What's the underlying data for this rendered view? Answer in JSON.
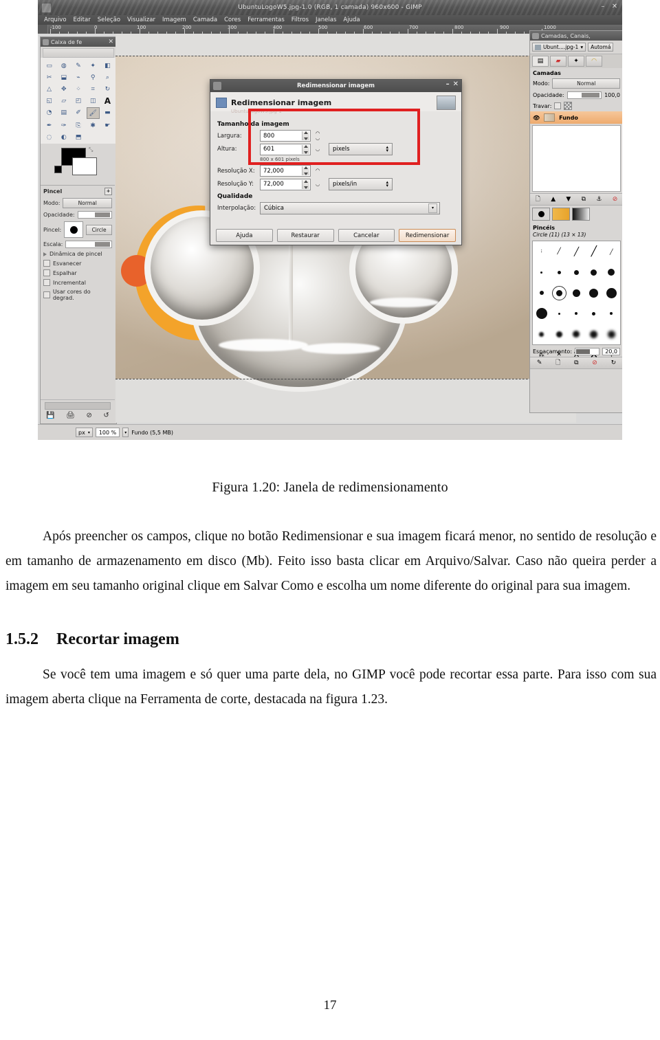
{
  "figure": {
    "window": {
      "title": "UbuntuLogoW5.jpg-1.0 (RGB, 1 camada) 960x600 - GIMP",
      "minimize": "–",
      "close": "✕"
    },
    "menubar": [
      "Arquivo",
      "Editar",
      "Seleção",
      "Visualizar",
      "Imagem",
      "Camada",
      "Cores",
      "Ferramentas",
      "Filtros",
      "Janelas",
      "Ajuda"
    ],
    "ruler": {
      "labels": [
        "-100",
        "0",
        "100",
        "200",
        "300",
        "400",
        "500",
        "600",
        "700",
        "800",
        "900",
        "1000"
      ]
    },
    "toolbox": {
      "title": "Caixa de fe",
      "close": "✕",
      "tools": [
        "rect-select-icon",
        "ellipse-select-icon",
        "free-select-icon",
        "fuzzy-select-icon",
        "select-by-color-icon",
        "scissors-select-icon",
        "foreground-select-icon",
        "paths-icon",
        "color-picker-icon",
        "zoom-icon",
        "measure-icon",
        "move-icon",
        "alignment-icon",
        "crop-icon",
        "rotate-icon",
        "scale-icon",
        "shear-icon",
        "perspective-icon",
        "flip-icon",
        "text-icon",
        "bucket-fill-icon",
        "gradient-icon",
        "pencil-icon",
        "paintbrush-icon",
        "eraser-icon",
        "airbrush-icon",
        "ink-icon",
        "clone-icon",
        "heal-icon",
        "smudge-icon",
        "blur-icon",
        "dodge-burn-icon",
        "perspective-clone-icon"
      ],
      "selected_tool_index": 23
    },
    "tool_options": {
      "title": "Pincel",
      "detach_icon": "detach-icon",
      "mode_label": "Modo:",
      "mode_value": "Normal",
      "opacity_label": "Opacidade:",
      "brush_label": "Pincel:",
      "brush_value": "Circle",
      "scale_label": "Escala:",
      "dynamics_label": "Dinâmica de pincel",
      "checkboxes": [
        "Esvanecer",
        "Espalhar",
        "Incremental",
        "Usar cores do degrad."
      ]
    },
    "right_dock": {
      "title": "Camadas, Canais,",
      "image_selector": "Ubunt....jpg-1",
      "auto_button": "Automá",
      "tabs": [
        "layers-tab-icon",
        "channels-tab-icon",
        "paths-tab-icon",
        "undo-tab-icon"
      ],
      "layers_section": "Camadas",
      "mode_label": "Modo:",
      "mode_value": "Normal",
      "opacity_label": "Opacidade:",
      "opacity_value": "100,0",
      "lock_label": "Travar:",
      "layer_name": "Fundo",
      "brushes_section": "Pincéis",
      "brush_current": "Circle (11) (13 × 13)",
      "spacing_label": "Espaçamento:",
      "spacing_value": "20,0"
    },
    "dialog": {
      "titlebar": "Redimensionar imagem",
      "minimize": "–",
      "close": "✕",
      "heading": "Redimensionar imagem",
      "subtitle": "UbuntuLogoW5.jpg-1",
      "section_size": "Tamanho da imagem",
      "width_label": "Largura:",
      "width_value": "800",
      "height_label": "Altura:",
      "height_value": "601",
      "size_unit": "pixels",
      "px_note": "800 x 601 pixels",
      "resx_label": "Resolução X:",
      "resx_value": "72,000",
      "resy_label": "Resolução Y:",
      "resy_value": "72,000",
      "res_unit": "pixels/in",
      "section_quality": "Qualidade",
      "interp_label": "Interpolação:",
      "interp_value": "Cúbica",
      "buttons": {
        "help": "Ajuda",
        "reset": "Restaurar",
        "cancel": "Cancelar",
        "resize": "Redimensionar"
      },
      "highlight_color": "#e02020"
    },
    "statusbar": {
      "unit": "px",
      "zoom": "100 %",
      "layer_info": "Fundo (5,5 MB)"
    }
  },
  "document": {
    "caption": "Figura 1.20: Janela de redimensionamento",
    "paragraph1": "Após preencher os campos, clique no botão Redimensionar e sua imagem ficará menor, no sentido de resolução e em tamanho de armazenamento em disco (Mb). Feito isso basta clicar em Arquivo/Salvar. Caso não queira perder a imagem em seu tamanho original clique em Salvar Como e escolha um nome diferente do original para sua imagem.",
    "heading_number": "1.5.2",
    "heading_text": "Recortar imagem",
    "paragraph2": "Se você tem uma imagem e só quer uma parte dela, no GIMP você pode recortar essa parte. Para isso com sua imagem aberta clique na Ferramenta de corte, destacada na figura 1.23.",
    "page_number": "17"
  }
}
